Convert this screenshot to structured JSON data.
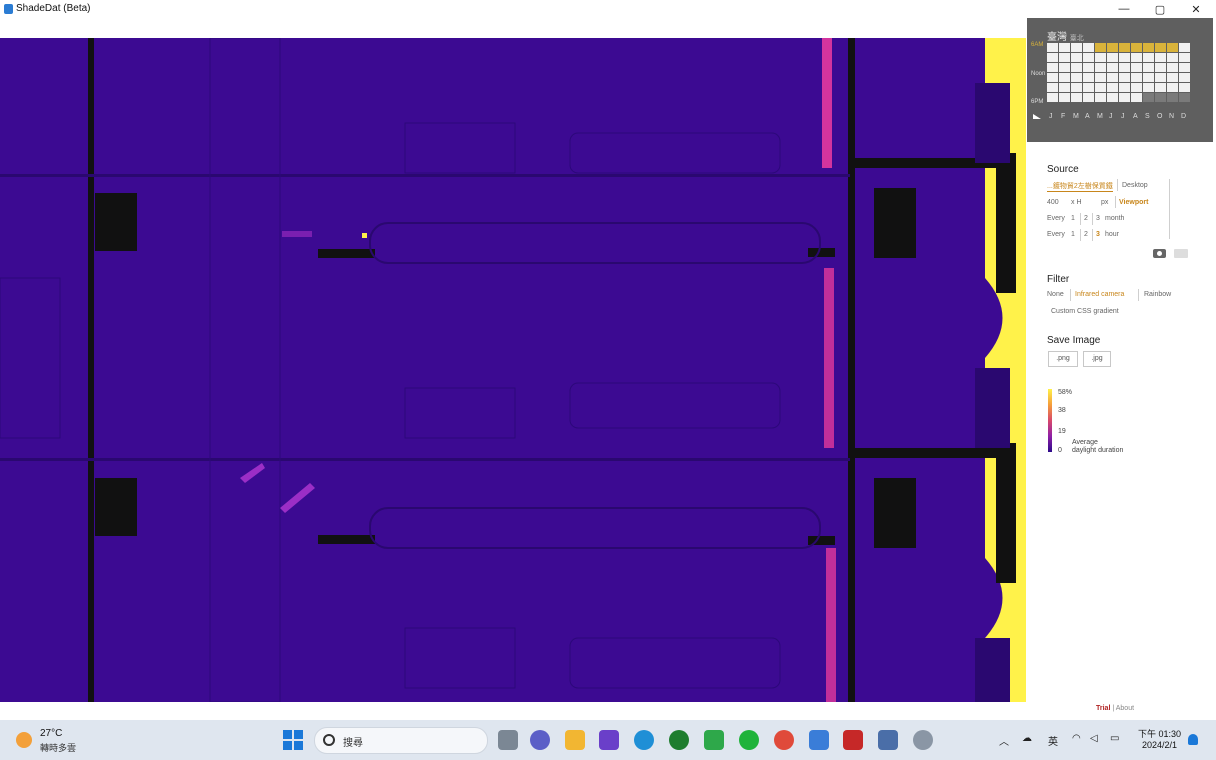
{
  "window": {
    "title": "ShadeDat (Beta)",
    "controls": {
      "minimize": "—",
      "maximize": "▢",
      "close": "✕"
    }
  },
  "calendar": {
    "location": "臺灣",
    "location_sub": "臺北",
    "row_labels": {
      "am": "6AM",
      "noon": "Noon",
      "pm": "6PM"
    },
    "months": [
      "J",
      "F",
      "M",
      "A",
      "M",
      "J",
      "J",
      "A",
      "S",
      "O",
      "N",
      "D"
    ],
    "colors": {
      "background": "#5f5f5f",
      "selected": "#d9b33b",
      "cell": "#f1f1f1"
    }
  },
  "source": {
    "title": "Source",
    "file_label": "...鍍物貿2左樹保質鐵",
    "desktop_label": "Desktop",
    "width_value": "400",
    "x_label": "x H",
    "px_label": "px",
    "viewport_label": "Viewport",
    "every_month": {
      "prefix": "Every",
      "options": [
        "1",
        "2",
        "3"
      ],
      "selected": "3",
      "unit": "month"
    },
    "every_hour": {
      "prefix": "Every",
      "options": [
        "1",
        "2",
        "3"
      ],
      "selected": "3",
      "unit": "hour"
    }
  },
  "filter": {
    "title": "Filter",
    "options": [
      "None",
      "Infrared camera",
      "Rainbow"
    ],
    "selected": "Infrared camera",
    "custom_label": "Custom CSS gradient"
  },
  "save_image": {
    "title": "Save Image",
    "png": ".png",
    "jpg": ".jpg"
  },
  "legend": {
    "ticks": [
      "58%",
      "38",
      "19",
      "0"
    ],
    "caption_line1": "Average",
    "caption_line2": "daylight duration",
    "gradient_colors": [
      "#fff24a",
      "#f59e3a",
      "#d8486b",
      "#8f1fa6",
      "#2c0a8a"
    ]
  },
  "footer": {
    "trial": "Trial",
    "sep": "|",
    "about": "About"
  },
  "taskbar": {
    "weather_temp": "27°C",
    "weather_desc": "轉時多雲",
    "search_placeholder": "搜尋",
    "tray_lang": "英",
    "clock_time": "下午 01:30",
    "clock_date": "2024/2/1"
  },
  "colors": {
    "viewport_bg": "#3c0a92",
    "accent": "#c8861b",
    "highlight_yellow": "#fff24a",
    "magenta": "#d3349e"
  }
}
